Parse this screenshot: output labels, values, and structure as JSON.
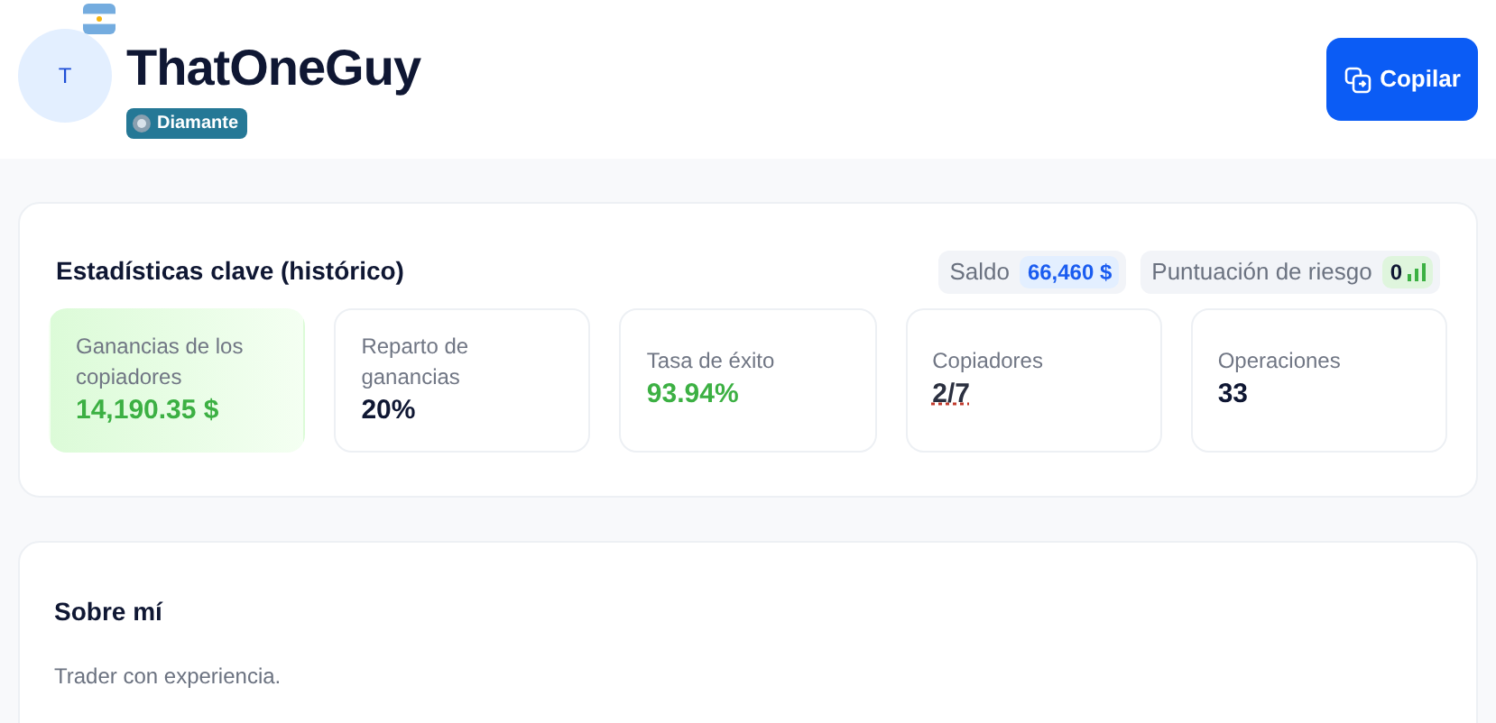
{
  "profile": {
    "avatar_initial": "T",
    "name": "ThatOneGuy",
    "badge": "Diamante"
  },
  "copy_button": {
    "label": "Copilar"
  },
  "key_stats": {
    "title": "Estadísticas clave (histórico)",
    "pills": [
      {
        "label": "Saldo",
        "value": "66,460 $",
        "kind": "balance"
      },
      {
        "label": "Puntuación de riesgo",
        "value": "0",
        "kind": "risk"
      }
    ],
    "stats": [
      {
        "label": "Ganancias de los copiadores",
        "value": "14,190.35 $",
        "kind": "positive",
        "highlighted": true
      },
      {
        "label": "Reparto de ganancias",
        "value": "20%",
        "kind": "neutral",
        "highlighted": false
      },
      {
        "label": "Tasa de éxito",
        "value": "93.94%",
        "kind": "positive",
        "highlighted": false
      },
      {
        "label": "Copiadores",
        "value": "2/7",
        "kind": "underlined",
        "highlighted": false
      },
      {
        "label": "Operaciones",
        "value": "33",
        "kind": "neutral",
        "highlighted": false
      }
    ]
  },
  "about": {
    "title": "Sobre mí",
    "text": "Trader con experiencia."
  }
}
